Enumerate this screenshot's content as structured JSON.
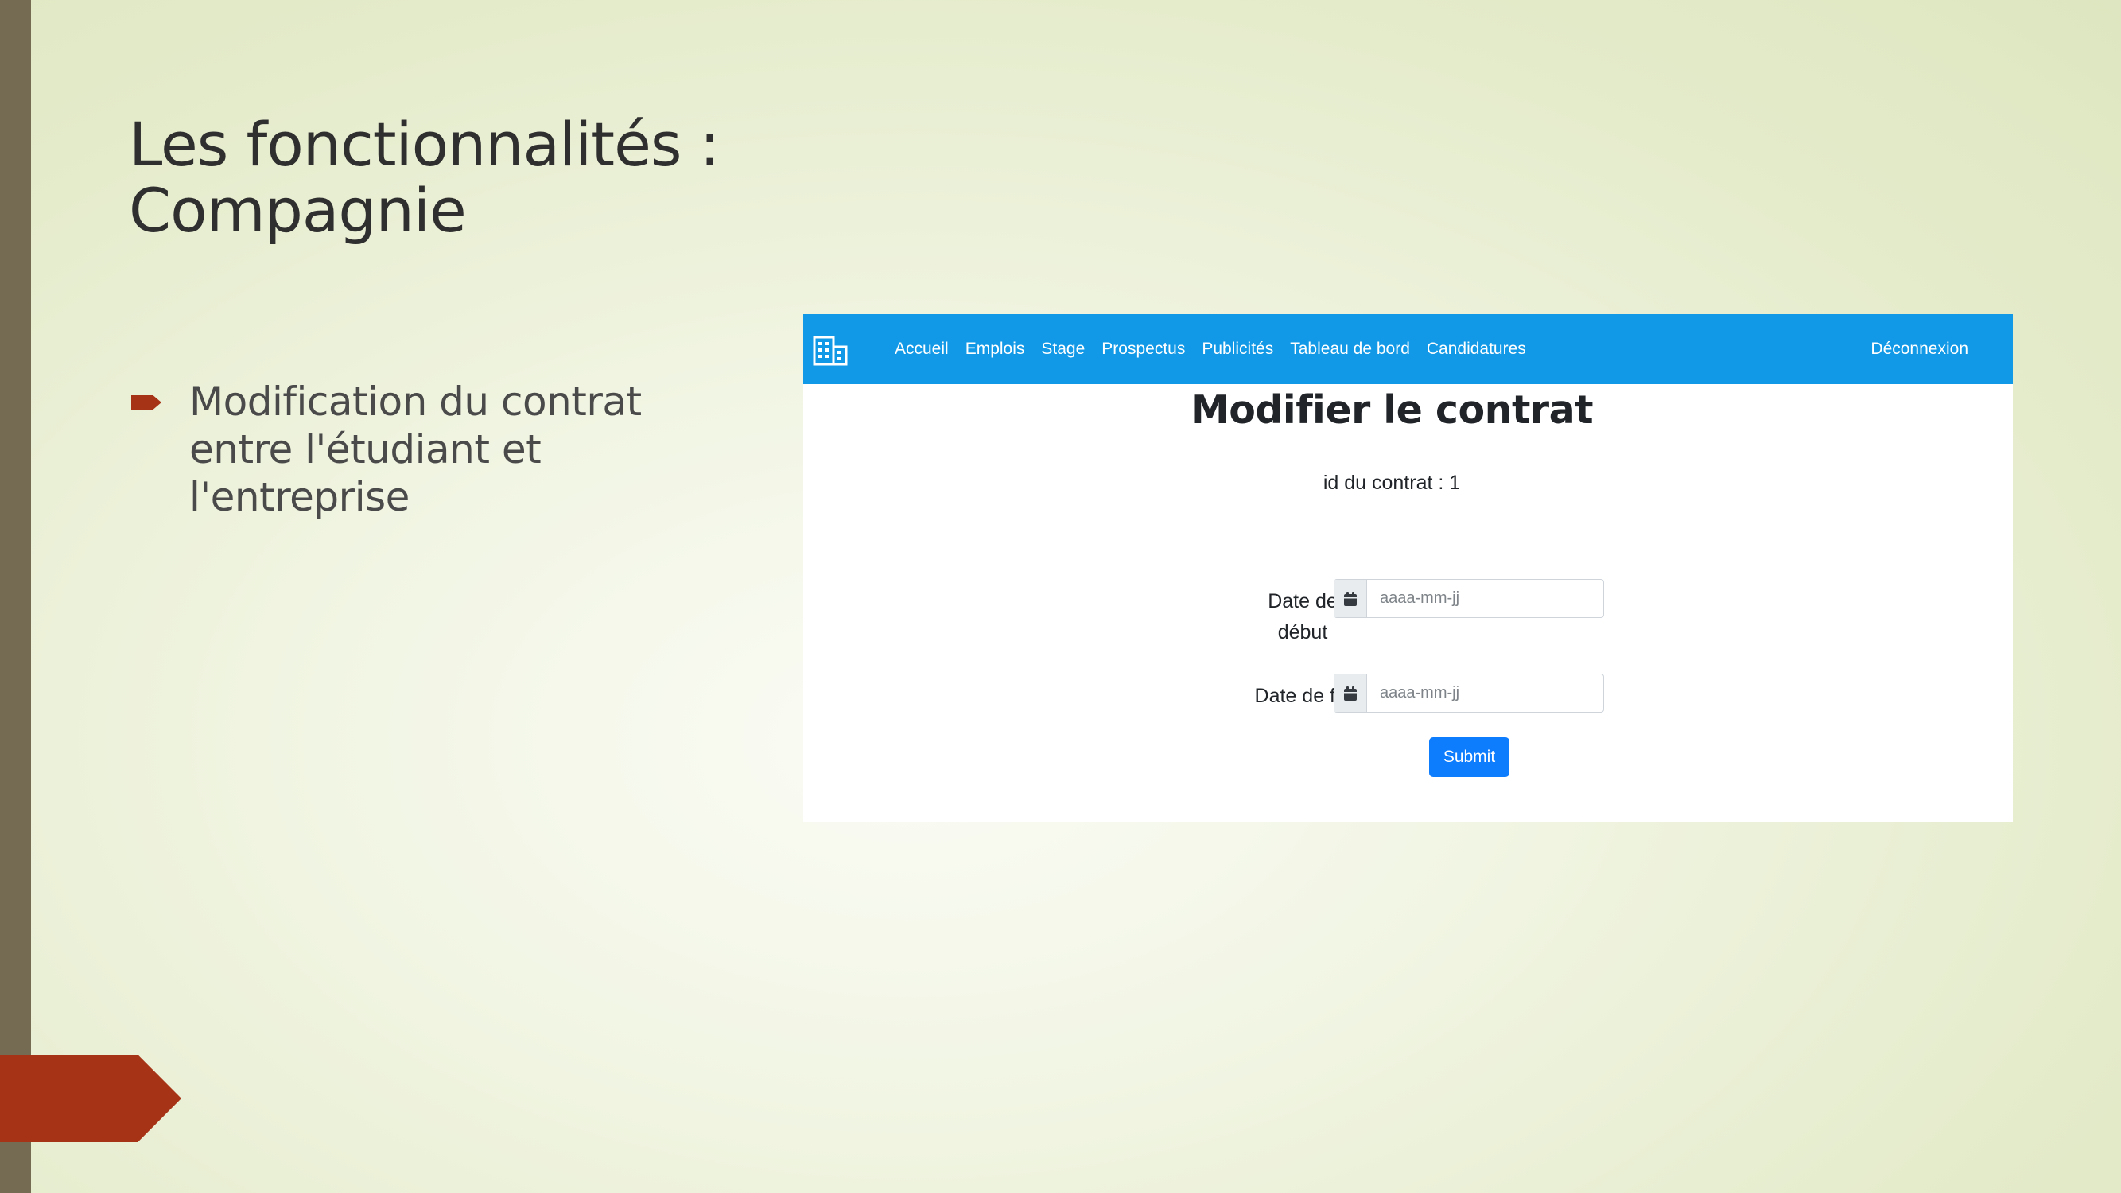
{
  "slide": {
    "title_lines": [
      "Les fonctionnalités :",
      "Compagnie"
    ],
    "bullets": [
      {
        "lines": [
          "Modification du contrat",
          "entre l'étudiant et",
          "l'entreprise"
        ]
      }
    ],
    "colors": {
      "sidebar": "#746b52",
      "accent": "#a73316",
      "background": "#e4ebca"
    }
  },
  "app": {
    "brand_icon": "building-icon",
    "navbar": {
      "color": "#1199e7",
      "links": [
        "Accueil",
        "Emplois",
        "Stage",
        "Prospectus",
        "Publicités",
        "Tableau de bord",
        "Candidatures"
      ],
      "logout_label": "Déconnexion"
    },
    "heading": "Modifier le contrat",
    "contract_id_text": "id du contrat : 1",
    "form": {
      "start_date": {
        "label_lines": [
          "Date de",
          "début"
        ],
        "placeholder": "aaaa-mm-jj",
        "value": "",
        "icon": "calendar-icon"
      },
      "end_date": {
        "label": "Date de fin",
        "placeholder": "aaaa-mm-jj",
        "value": "",
        "icon": "calendar-icon"
      },
      "submit_label": "Submit",
      "submit_color": "#0d7cfd"
    }
  }
}
